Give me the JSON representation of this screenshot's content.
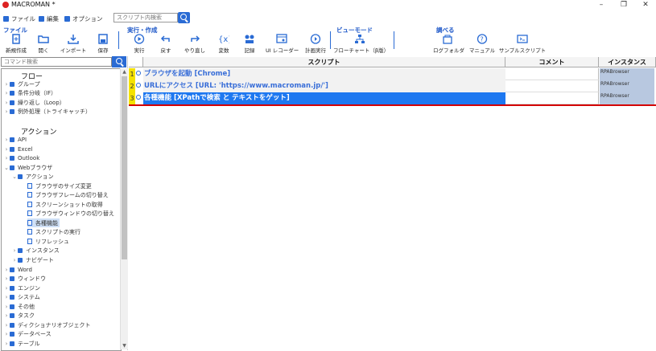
{
  "window": {
    "title": "MACROMAN *",
    "controls": [
      "–",
      "❐",
      "✕"
    ]
  },
  "menubar": {
    "items": [
      {
        "label": "ファイル"
      },
      {
        "label": "編集"
      },
      {
        "label": "オプション"
      }
    ],
    "search_placeholder": "スクリプト内検索"
  },
  "ribbon": {
    "groups": [
      {
        "label": "ファイル"
      },
      {
        "label": "実行・作成"
      },
      {
        "label": "ビューモード"
      },
      {
        "label": "調べる"
      }
    ],
    "buttons": [
      {
        "label": "新規作成",
        "icon": "new-file-icon"
      },
      {
        "label": "開く",
        "icon": "folder-open-icon"
      },
      {
        "label": "インポート",
        "icon": "import-icon"
      },
      {
        "label": "保存",
        "icon": "save-icon"
      },
      {
        "label": "実行",
        "icon": "play-icon"
      },
      {
        "label": "戻す",
        "icon": "undo-icon"
      },
      {
        "label": "やり直し",
        "icon": "redo-icon"
      },
      {
        "label": "変数",
        "icon": "variable-icon"
      },
      {
        "label": "記録",
        "icon": "record-icon"
      },
      {
        "label": "UI レコーダー",
        "icon": "ui-recorder-icon"
      },
      {
        "label": "計画実行",
        "icon": "schedule-icon"
      },
      {
        "label": "フローチャート（β版）",
        "icon": "flowchart-icon"
      },
      {
        "label": "ログフォルダ",
        "icon": "log-folder-icon"
      },
      {
        "label": "マニュアル",
        "icon": "help-icon"
      },
      {
        "label": "サンプルスクリプト",
        "icon": "sample-script-icon"
      }
    ]
  },
  "left_panel": {
    "search_placeholder": "コマンド検索",
    "sections": {
      "flow": "フロー",
      "action": "アクション"
    },
    "flow_items": [
      "グループ",
      "条件分岐（IF）",
      "繰り返し（Loop）",
      "例外処理（トライキャッチ）"
    ],
    "action_items_top": [
      "API",
      "Excel",
      "Outlook",
      "Webブラウザ"
    ],
    "webbrowser_children": {
      "action_label": "アクション",
      "actions": [
        "ブラウザのサイズ変更",
        "ブラウザフレームの切り替え",
        "スクリーンショットの取得",
        "ブラウザウィンドウの切り替え",
        "各種機能",
        "スクリプトの実行",
        "リフレッシュ"
      ],
      "instance_label": "インスタンス",
      "navigate_label": "ナビゲート"
    },
    "action_items_bottom": [
      "Word",
      "ウィンドウ",
      "エンジン",
      "システム",
      "その他",
      "タスク",
      "ディクショナリオブジェクト",
      "データベース",
      "テーブル"
    ]
  },
  "grid": {
    "headers": {
      "script": "スクリプト",
      "comment": "コメント",
      "instance": "インスタンス"
    },
    "rows": [
      {
        "num": "1",
        "script": "ブラウザを起動 [Chrome]",
        "instance": "RPABrowser",
        "selected": false
      },
      {
        "num": "2",
        "script": "URLにアクセス [URL: 'https://www.macroman.jp/']",
        "instance": "RPABrowser",
        "selected": false
      },
      {
        "num": "3",
        "script": "各種機能 [XPathで検索 と テキストをゲット]",
        "instance": "RPABrowser",
        "selected": true
      }
    ]
  },
  "colors": {
    "accent": "#2a6bd4",
    "row_text": "#3a6fd8",
    "selected_bg": "#1e78f0",
    "row_number_bg": "#f4e200",
    "instance_bg": "#b8c8e0",
    "red_line": "#d40000"
  }
}
